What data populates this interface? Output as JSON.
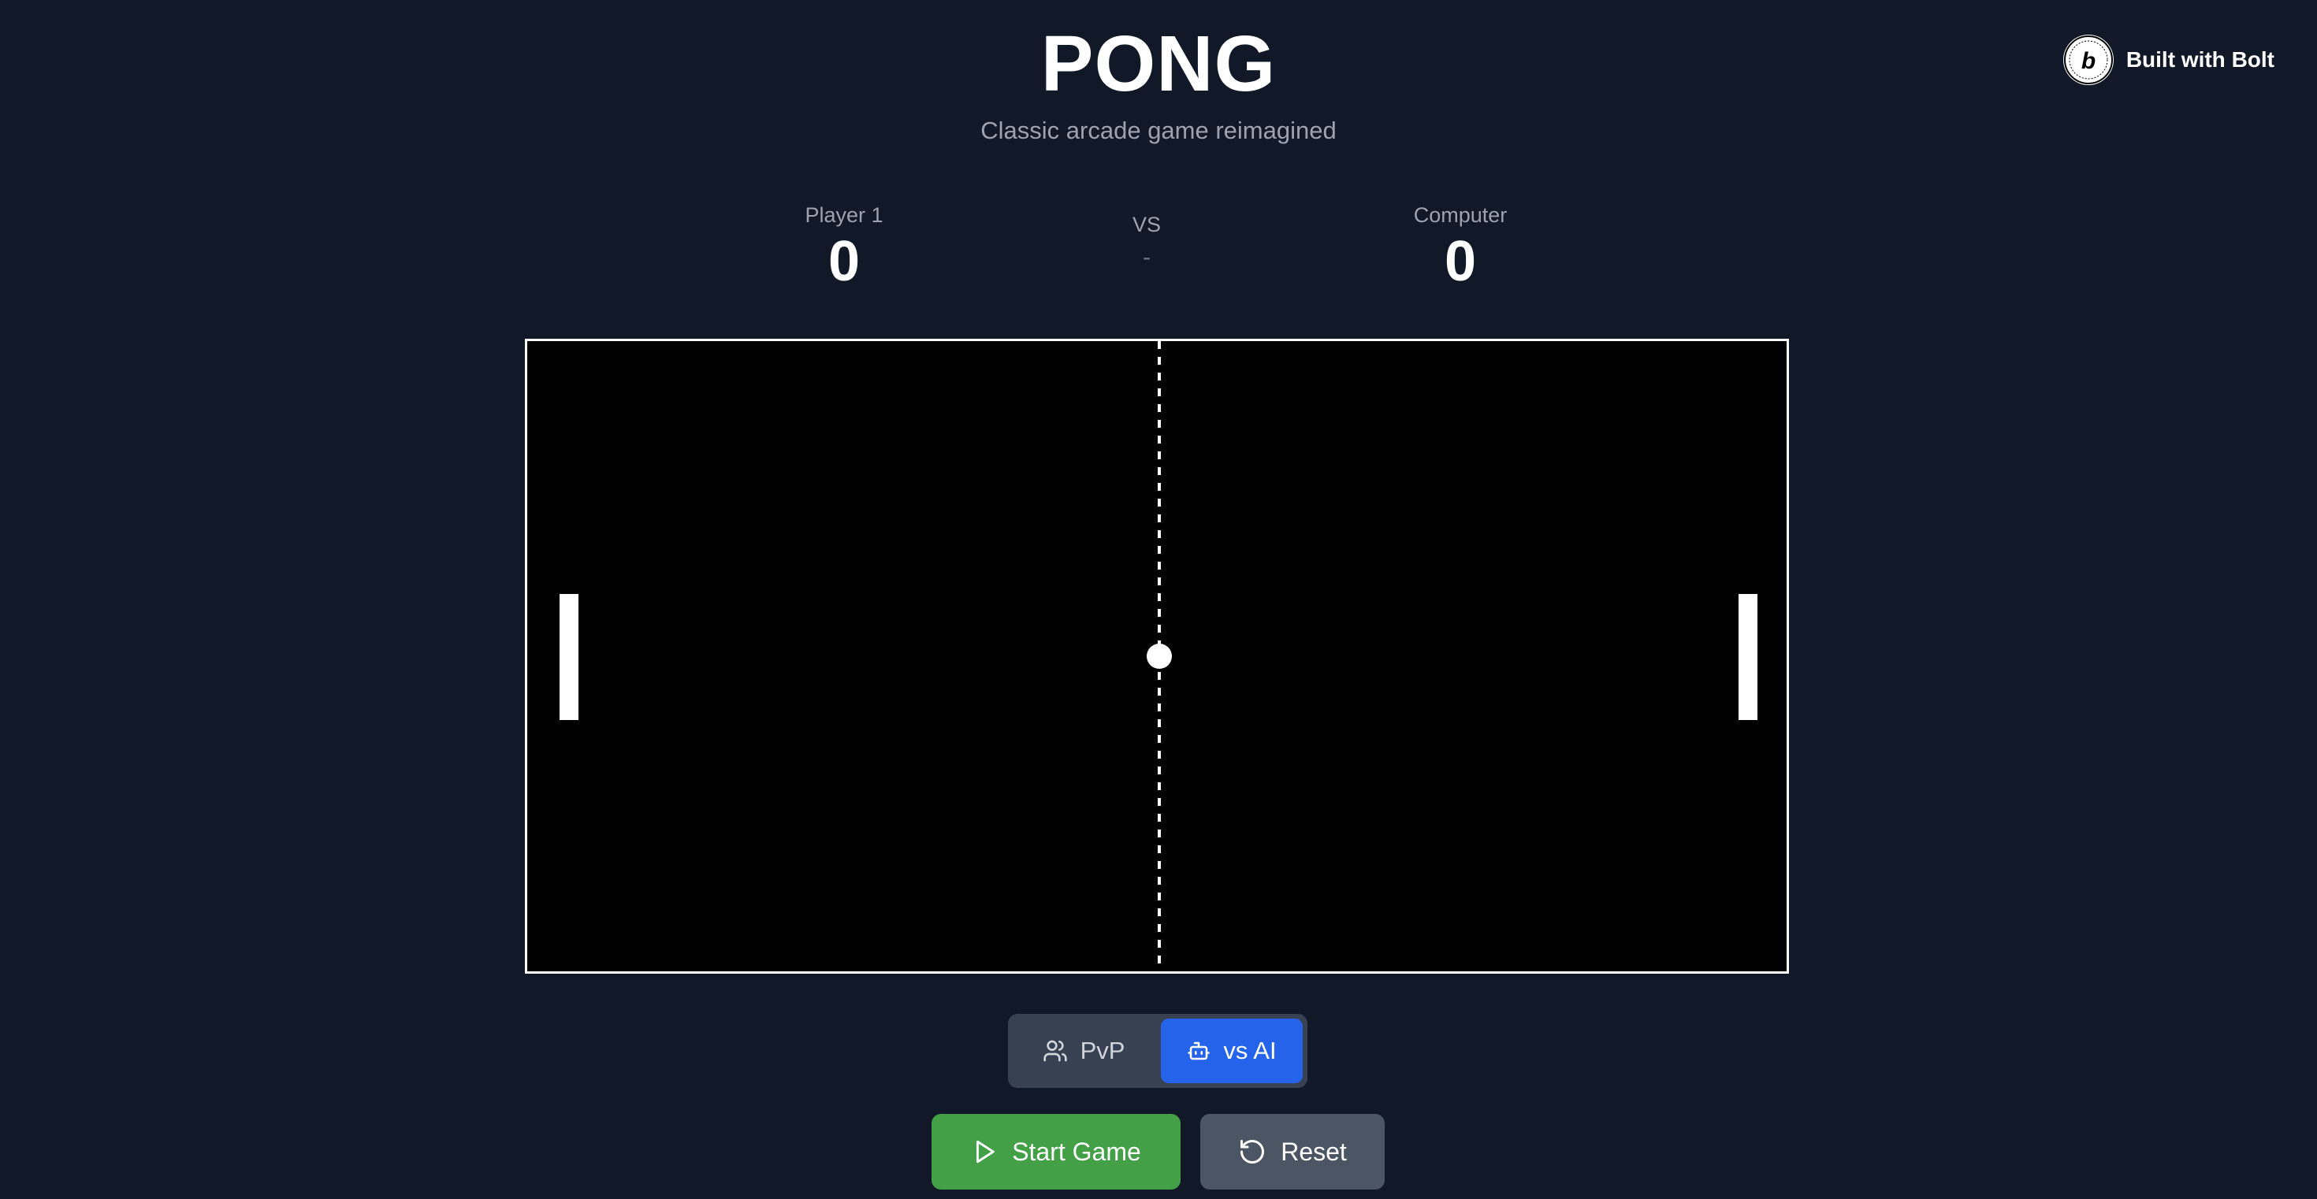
{
  "header": {
    "title": "PONG",
    "subtitle": "Classic arcade game reimagined"
  },
  "badge": {
    "label": "Built with Bolt",
    "logo_icon": "bolt-logo-icon"
  },
  "scoreboard": {
    "player1": {
      "label": "Player 1",
      "score": "0"
    },
    "vs": {
      "label": "VS",
      "status": "-"
    },
    "player2": {
      "label": "Computer",
      "score": "0"
    }
  },
  "mode_toggle": {
    "options": [
      {
        "label": "PvP",
        "icon": "users-icon",
        "selected": false
      },
      {
        "label": "vs AI",
        "icon": "bot-icon",
        "selected": true
      }
    ]
  },
  "controls": {
    "start_label": "Start Game",
    "start_icon": "play-icon",
    "reset_label": "Reset",
    "reset_icon": "rotate-ccw-icon"
  },
  "colors": {
    "background": "#111827",
    "board": "#000000",
    "accent_blue": "#2563eb",
    "start_green": "#43a047",
    "reset_gray": "#4b5563",
    "toggle_bg": "#374151"
  }
}
